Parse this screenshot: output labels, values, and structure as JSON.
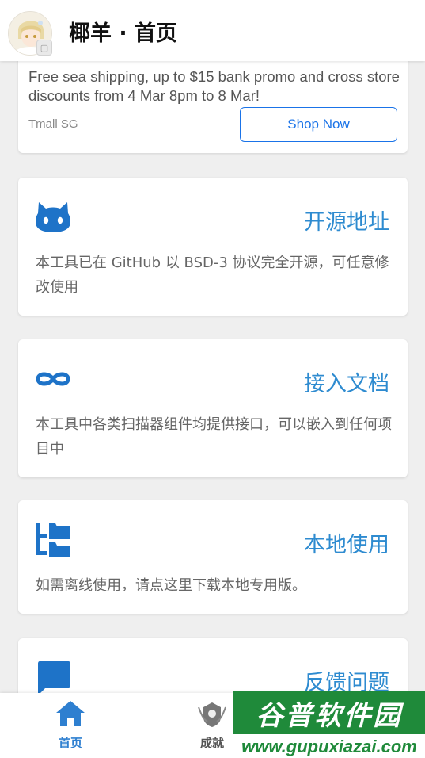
{
  "header": {
    "title": "椰羊 · 首页"
  },
  "ad": {
    "text": "Free sea shipping, up to $15 bank promo and cross store discounts from 4 Mar 8pm to 8 Mar!",
    "source": "Tmall SG",
    "cta_label": "Shop Now"
  },
  "features": [
    {
      "icon": "github-icon",
      "title": "开源地址",
      "desc": "本工具已在 GitHub 以 BSD-3 协议完全开源，可任意修改使用"
    },
    {
      "icon": "infinity-icon",
      "title": "接入文档",
      "desc": "本工具中各类扫描器组件均提供接口，可以嵌入到任何项目中"
    },
    {
      "icon": "folder-tree-icon",
      "title": "本地使用",
      "desc": "如需离线使用，请点这里下载本地专用版。"
    },
    {
      "icon": "chat-bubble-icon",
      "title": "反馈问题",
      "desc": ""
    }
  ],
  "nav": {
    "home_label": "首页",
    "achievements_label": "成就"
  },
  "watermark": {
    "cn": "谷普软件园",
    "url": "www.gupuxiazai.com"
  },
  "colors": {
    "accent": "#2e8bd0",
    "icon_blue": "#1e73c8",
    "ad_button": "#1a73e8",
    "background": "#efefef"
  }
}
